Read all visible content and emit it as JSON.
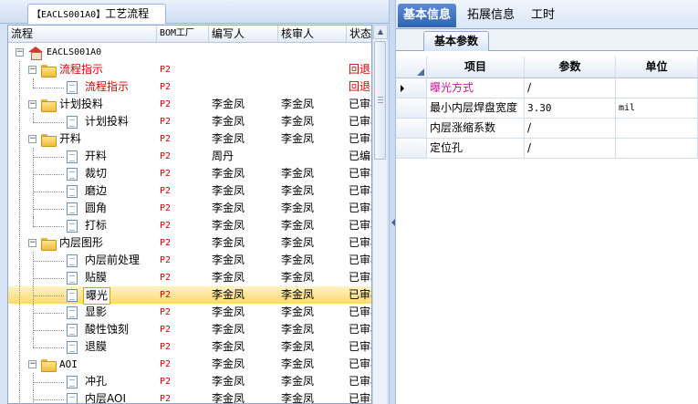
{
  "left_tab": {
    "code": "【EACLS001A0】",
    "title": "工艺流程"
  },
  "grid": {
    "columns": [
      "流程",
      "BOM工厂",
      "编写人",
      "核审人",
      "状态"
    ],
    "rows": [
      {
        "label": "EACLS001A0",
        "bom": "",
        "author": "",
        "reviewer": "",
        "status": ""
      },
      {
        "label": "流程指示",
        "bom": "P2",
        "author": "",
        "reviewer": "",
        "status": "回退"
      },
      {
        "label": "流程指示",
        "bom": "P2",
        "author": "",
        "reviewer": "",
        "status": "回退"
      },
      {
        "label": "计划投料",
        "bom": "P2",
        "author": "李金凤",
        "reviewer": "李金凤",
        "status": "已审核"
      },
      {
        "label": "计划投料",
        "bom": "P2",
        "author": "李金凤",
        "reviewer": "李金凤",
        "status": "已审核"
      },
      {
        "label": "开料",
        "bom": "P2",
        "author": "李金凤",
        "reviewer": "李金凤",
        "status": "已审核"
      },
      {
        "label": "开料",
        "bom": "P2",
        "author": "周丹",
        "reviewer": "",
        "status": "已编写"
      },
      {
        "label": "裁切",
        "bom": "P2",
        "author": "李金凤",
        "reviewer": "李金凤",
        "status": "已审核"
      },
      {
        "label": "磨边",
        "bom": "P2",
        "author": "李金凤",
        "reviewer": "李金凤",
        "status": "已审核"
      },
      {
        "label": "圆角",
        "bom": "P2",
        "author": "李金凤",
        "reviewer": "李金凤",
        "status": "已审核"
      },
      {
        "label": "打标",
        "bom": "P2",
        "author": "李金凤",
        "reviewer": "李金凤",
        "status": "已审核"
      },
      {
        "label": "内层图形",
        "bom": "P2",
        "author": "李金凤",
        "reviewer": "李金凤",
        "status": "已审核"
      },
      {
        "label": "内层前处理",
        "bom": "P2",
        "author": "李金凤",
        "reviewer": "李金凤",
        "status": "已审核"
      },
      {
        "label": "贴膜",
        "bom": "P2",
        "author": "李金凤",
        "reviewer": "李金凤",
        "status": "已审核"
      },
      {
        "label": "曝光",
        "bom": "P2",
        "author": "李金凤",
        "reviewer": "李金凤",
        "status": "已审核"
      },
      {
        "label": "显影",
        "bom": "P2",
        "author": "李金凤",
        "reviewer": "李金凤",
        "status": "已审核"
      },
      {
        "label": "酸性蚀刻",
        "bom": "P2",
        "author": "李金凤",
        "reviewer": "李金凤",
        "status": "已审核"
      },
      {
        "label": "退膜",
        "bom": "P2",
        "author": "李金凤",
        "reviewer": "李金凤",
        "status": "已审核"
      },
      {
        "label": "AOI",
        "bom": "P2",
        "author": "李金凤",
        "reviewer": "李金凤",
        "status": "已审核"
      },
      {
        "label": "冲孔",
        "bom": "P2",
        "author": "李金凤",
        "reviewer": "李金凤",
        "status": "已审核"
      },
      {
        "label": "内层AOI",
        "bom": "P2",
        "author": "李金凤",
        "reviewer": "李金凤",
        "status": "已审核"
      }
    ]
  },
  "right_tabs": [
    "基本信息",
    "拓展信息",
    "工时"
  ],
  "sub_tab": "基本参数",
  "params": {
    "columns": [
      "项目",
      "参数",
      "单位"
    ],
    "rows": [
      {
        "name": "曝光方式",
        "value": "/",
        "unit": ""
      },
      {
        "name": "最小内层焊盘宽度",
        "value": "3.30",
        "unit": "mil"
      },
      {
        "name": "内层涨缩系数",
        "value": "/",
        "unit": ""
      },
      {
        "name": "定位孔",
        "value": "/",
        "unit": ""
      }
    ]
  }
}
